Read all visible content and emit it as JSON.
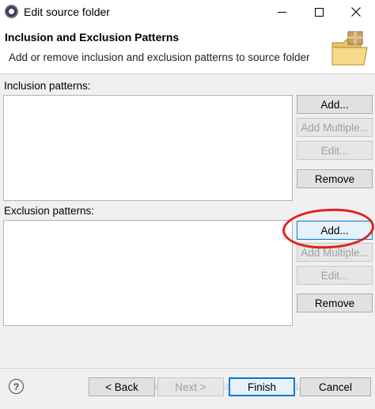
{
  "window": {
    "title": "Edit source folder",
    "icon": "eclipse-icon"
  },
  "header": {
    "title": "Inclusion and Exclusion Patterns",
    "description": "Add or remove inclusion and exclusion patterns to source folder",
    "banner_icon": "folder-package-icon"
  },
  "inclusion": {
    "label": "Inclusion patterns:",
    "buttons": {
      "add": "Add...",
      "add_multiple": "Add Multiple...",
      "edit": "Edit...",
      "remove": "Remove"
    },
    "items": []
  },
  "exclusion": {
    "label": "Exclusion patterns:",
    "buttons": {
      "add": "Add...",
      "add_multiple": "Add Multiple...",
      "edit": "Edit...",
      "remove": "Remove"
    },
    "items": []
  },
  "footer": {
    "help": "?",
    "back": "< Back",
    "next": "Next >",
    "finish": "Finish",
    "cancel": "Cancel"
  },
  "watermark": "https://blog.csdn.net/weixin_38598597",
  "colors": {
    "annotation": "#e0201c",
    "focus": "#0078d7",
    "disabled_text": "#a0a0a0"
  }
}
